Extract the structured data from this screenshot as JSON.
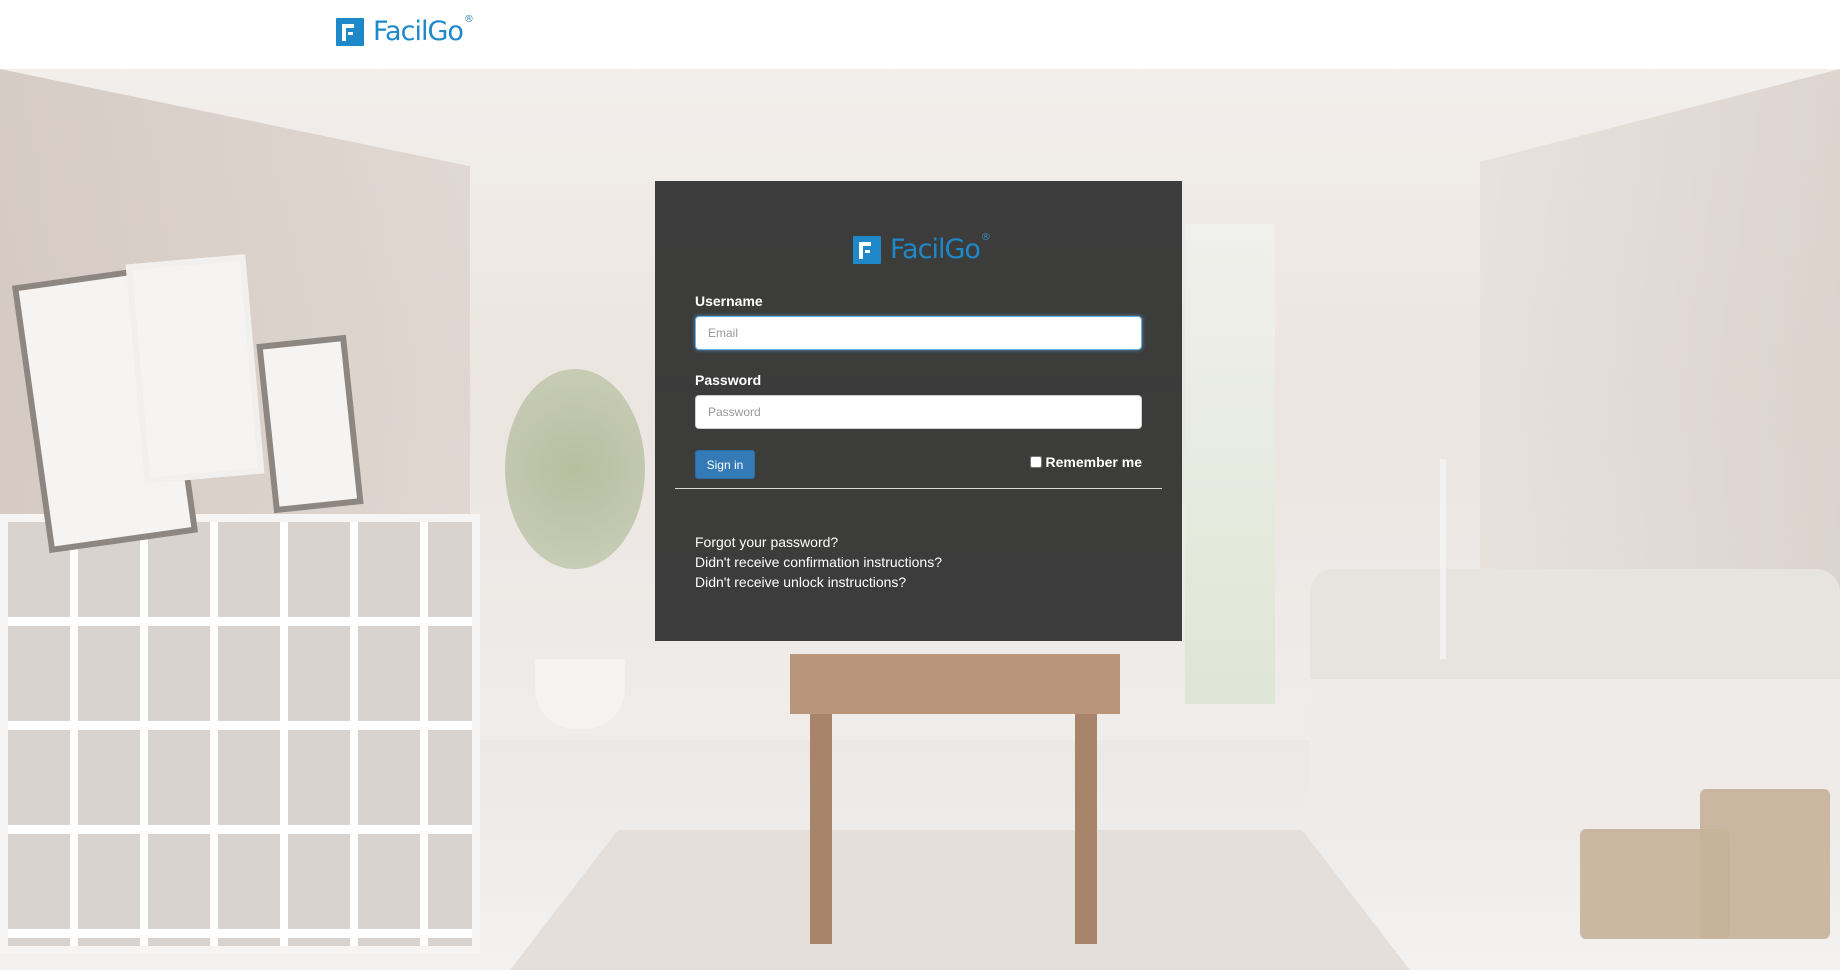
{
  "header": {
    "brand": "FacilGo",
    "registered": "®"
  },
  "login": {
    "brand": "FacilGo",
    "registered": "®",
    "username_label": "Username",
    "username_placeholder": "Email",
    "password_label": "Password",
    "password_placeholder": "Password",
    "sign_in_label": "Sign in",
    "remember_label": "Remember me",
    "links": [
      "Forgot your password?",
      "Didn't receive confirmation instructions?",
      "Didn't receive unlock instructions?"
    ]
  },
  "colors": {
    "brand": "#1e88c8",
    "panel": "#2e2e2e",
    "button": "#337ab7"
  }
}
